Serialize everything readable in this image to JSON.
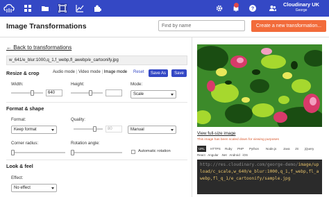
{
  "nav": {
    "account_name": "Cloudinary UK",
    "account_user": "George",
    "icons": [
      "dashboard-icon",
      "media-library-icon",
      "transformations-icon",
      "reports-icon",
      "addons-icon",
      "settings-icon",
      "notifications-icon",
      "help-icon",
      "users-icon"
    ]
  },
  "header": {
    "title": "Image Transformations",
    "search_placeholder": "Find by name",
    "create_button": "Create a new transformation..."
  },
  "left": {
    "back_link": "← Back to transformations",
    "transformation_string": "w_641/e_blur:1000,q_1,f_webp,fl_awebp/e_cartoonify.jpg",
    "resize_crop": {
      "title": "Resize & crop",
      "audio_mode": "Audio mode",
      "video_mode": "Video mode",
      "image_mode": "Image mode",
      "separator": "|",
      "reset": "Reset",
      "save_as": "Save As",
      "save": "Save",
      "width_label": "Width:",
      "width_value": "640",
      "height_label": "Height:",
      "mode_label": "Mode:",
      "mode_value": "Scale"
    },
    "format_shape": {
      "title": "Format & shape",
      "format_label": "Format:",
      "format_value": "Keep format",
      "quality_label": "Quality:",
      "quality_value": "80",
      "quality_mode": "Manual",
      "corner_label": "Corner radius:",
      "rotation_label": "Rotation angle:",
      "auto_rotation": "Automatic rotation"
    },
    "look_feel": {
      "title": "Look & feel",
      "effect_label": "Effect:",
      "effect_value": "No effect"
    }
  },
  "right": {
    "view_full": "View full-size image",
    "scaled_note": "This image has been scaled down for viewing purposes",
    "code_tabs": [
      "URL",
      "HTTPS",
      "Ruby",
      "PHP",
      "Python",
      "Node.js",
      "Java",
      "JS",
      "jQuery"
    ],
    "code_tabs_row2": "React   Angular   .Net   Android   iOS",
    "code_prefix": "http://res.cloudinary.com/george-demo/",
    "code_path": "image/upload/c_scale,w_640/e_blur:1000,q_1,f_webp,fl_awebp,fl_q_1/e_cartoonify/sample.jpg"
  },
  "colors": {
    "brand": "#3448c5",
    "accent": "#f26b3a"
  }
}
